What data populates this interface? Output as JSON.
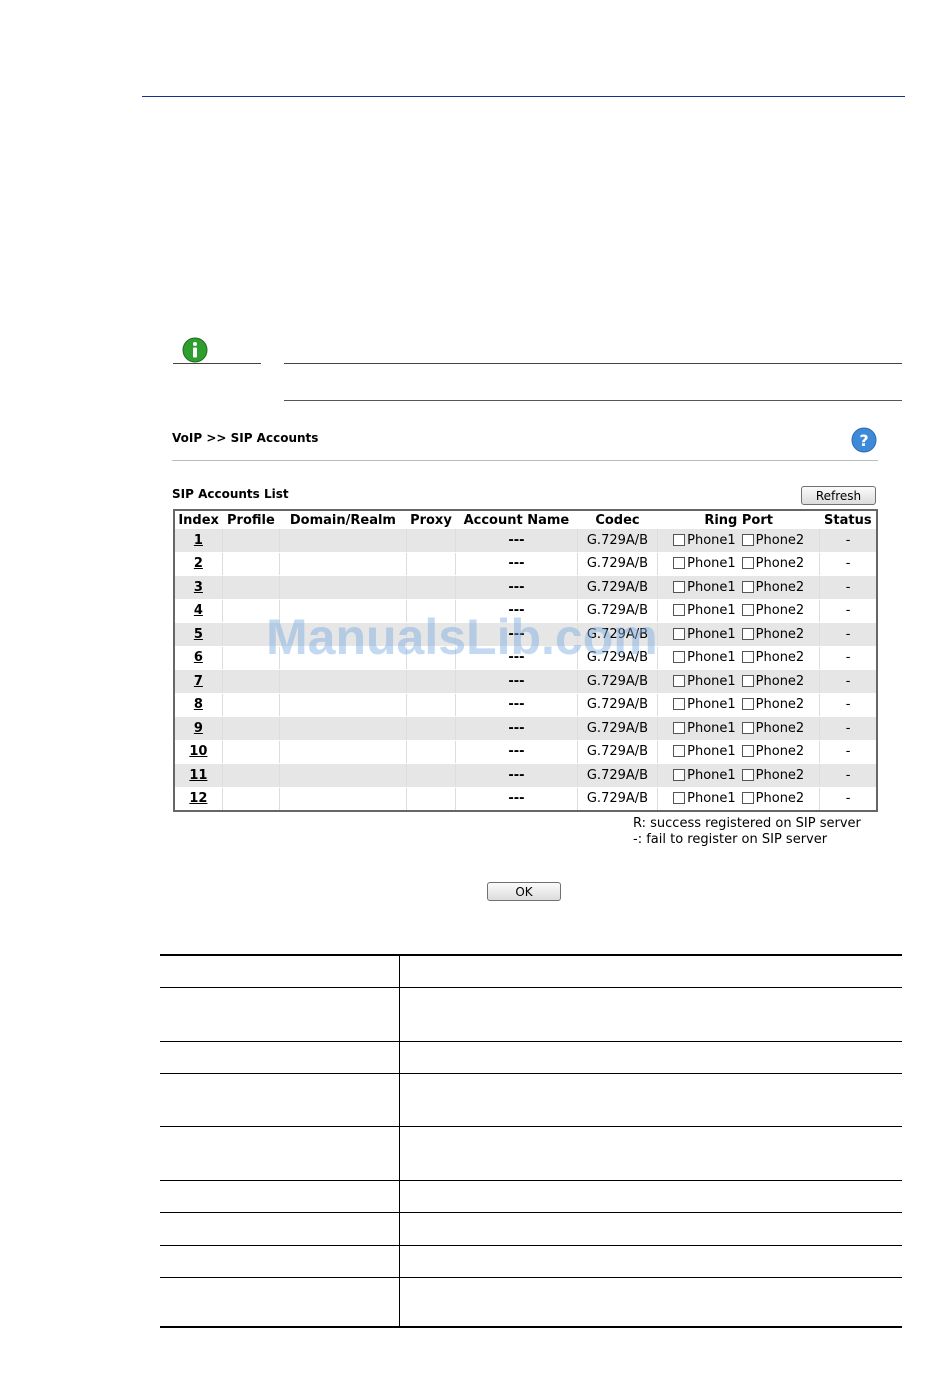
{
  "breadcrumb": "VoIP >> SIP Accounts",
  "list_title": "SIP Accounts List",
  "refresh_label": "Refresh",
  "ok_label": "OK",
  "watermark": "ManualsLib.com",
  "headers": [
    "Index",
    "Profile",
    "Domain/Realm",
    "Proxy",
    "Account Name",
    "Codec",
    "Ring Port",
    "Status"
  ],
  "rows": [
    {
      "index": "1",
      "profile": "",
      "domain": "",
      "proxy": "",
      "account": "---",
      "codec": "G.729A/B",
      "phone1": "Phone1",
      "phone2": "Phone2",
      "status": "-"
    },
    {
      "index": "2",
      "profile": "",
      "domain": "",
      "proxy": "",
      "account": "---",
      "codec": "G.729A/B",
      "phone1": "Phone1",
      "phone2": "Phone2",
      "status": "-"
    },
    {
      "index": "3",
      "profile": "",
      "domain": "",
      "proxy": "",
      "account": "---",
      "codec": "G.729A/B",
      "phone1": "Phone1",
      "phone2": "Phone2",
      "status": "-"
    },
    {
      "index": "4",
      "profile": "",
      "domain": "",
      "proxy": "",
      "account": "---",
      "codec": "G.729A/B",
      "phone1": "Phone1",
      "phone2": "Phone2",
      "status": "-"
    },
    {
      "index": "5",
      "profile": "",
      "domain": "",
      "proxy": "",
      "account": "---",
      "codec": "G.729A/B",
      "phone1": "Phone1",
      "phone2": "Phone2",
      "status": "-"
    },
    {
      "index": "6",
      "profile": "",
      "domain": "",
      "proxy": "",
      "account": "---",
      "codec": "G.729A/B",
      "phone1": "Phone1",
      "phone2": "Phone2",
      "status": "-"
    },
    {
      "index": "7",
      "profile": "",
      "domain": "",
      "proxy": "",
      "account": "---",
      "codec": "G.729A/B",
      "phone1": "Phone1",
      "phone2": "Phone2",
      "status": "-"
    },
    {
      "index": "8",
      "profile": "",
      "domain": "",
      "proxy": "",
      "account": "---",
      "codec": "G.729A/B",
      "phone1": "Phone1",
      "phone2": "Phone2",
      "status": "-"
    },
    {
      "index": "9",
      "profile": "",
      "domain": "",
      "proxy": "",
      "account": "---",
      "codec": "G.729A/B",
      "phone1": "Phone1",
      "phone2": "Phone2",
      "status": "-"
    },
    {
      "index": "10",
      "profile": "",
      "domain": "",
      "proxy": "",
      "account": "---",
      "codec": "G.729A/B",
      "phone1": "Phone1",
      "phone2": "Phone2",
      "status": "-"
    },
    {
      "index": "11",
      "profile": "",
      "domain": "",
      "proxy": "",
      "account": "---",
      "codec": "G.729A/B",
      "phone1": "Phone1",
      "phone2": "Phone2",
      "status": "-"
    },
    {
      "index": "12",
      "profile": "",
      "domain": "",
      "proxy": "",
      "account": "---",
      "codec": "G.729A/B",
      "phone1": "Phone1",
      "phone2": "Phone2",
      "status": "-"
    }
  ],
  "legend": [
    "R: success registered on SIP server",
    "-: fail to register on SIP server"
  ],
  "colors": {
    "rule_blue": "#1a2f8a",
    "row_stripe": "#e6e6e6",
    "info_green": "#2e9e2e",
    "help_blue": "#3d8ad8"
  }
}
